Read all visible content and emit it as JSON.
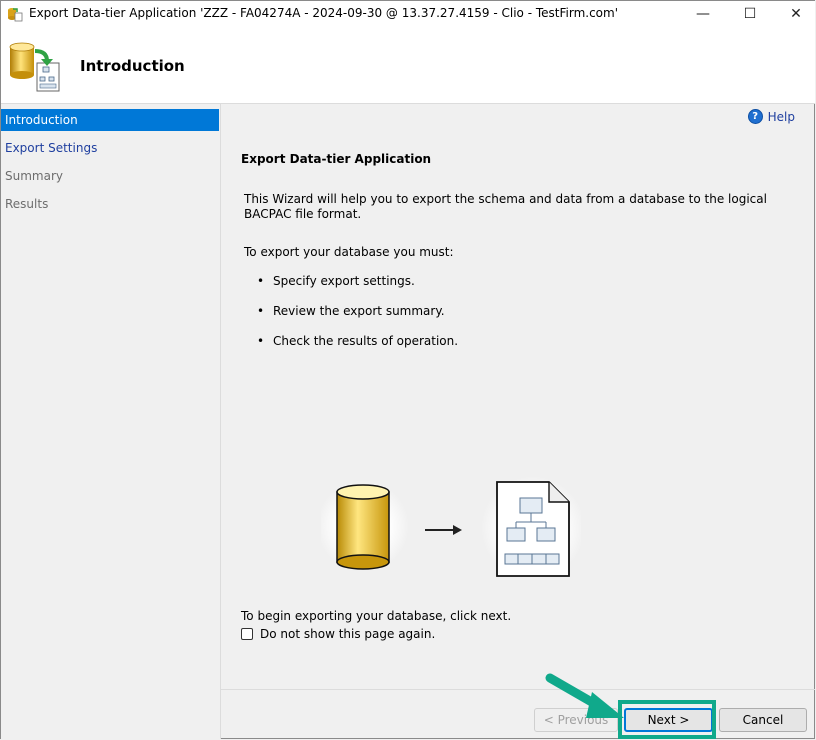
{
  "window": {
    "title": "Export Data-tier Application 'ZZZ - FA04274A - 2024-09-30 @ 13.37.27.4159 - Clio - TestFirm.com'",
    "controls": {
      "minimize": "—",
      "maximize": "☐",
      "close": "✕"
    }
  },
  "header": {
    "title": "Introduction",
    "icon": "database-export-icon"
  },
  "sidebar": {
    "items": [
      {
        "label": "Introduction",
        "state": "active"
      },
      {
        "label": "Export Settings",
        "state": "link"
      },
      {
        "label": "Summary",
        "state": "disabled"
      },
      {
        "label": "Results",
        "state": "disabled"
      }
    ]
  },
  "main": {
    "help_label": "Help",
    "section_title": "Export Data-tier Application",
    "intro_text": "This Wizard will help you to export the schema and data from a database to the logical BACPAC file format.",
    "must_text": "To export your database you must:",
    "bullets": [
      "Specify export settings.",
      "Review the export summary.",
      "Check the results of operation."
    ],
    "begin_text": "To begin exporting your database, click next.",
    "checkbox_label": "Do not show this page again.",
    "checkbox_checked": false
  },
  "footer": {
    "previous_label": "< Previous",
    "next_label": "Next >",
    "cancel_label": "Cancel"
  },
  "colors": {
    "accent": "#0078d7",
    "highlight": "#10a98b"
  }
}
